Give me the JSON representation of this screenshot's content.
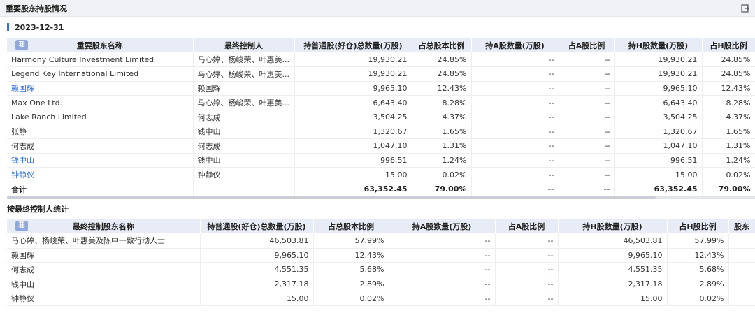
{
  "header": {
    "title": "重要股东持股情况",
    "export_icon": "export-icon"
  },
  "date_label": "2023-12-31",
  "sort_badge": "荘",
  "table1": {
    "columns": [
      "重要股东名称",
      "最终控制人",
      "持普通股(好仓)总数量(万股)",
      "占总股本比例",
      "持A股数量(万股)",
      "占A股比例",
      "持H股数量(万股)",
      "占H股比例"
    ],
    "rows": [
      [
        "Harmony Culture Investment Limited",
        "马心婷、杨峻荣、叶惠美...",
        "19,930.21",
        "24.85%",
        "--",
        "--",
        "19,930.21",
        "24.85%"
      ],
      [
        "Legend Key International Limited",
        "马心婷、杨峻荣、叶惠美...",
        "19,930.21",
        "24.85%",
        "--",
        "--",
        "19,930.21",
        "24.85%"
      ],
      [
        "赖国辉",
        "赖国辉",
        "9,965.10",
        "12.43%",
        "--",
        "--",
        "9,965.10",
        "12.43%"
      ],
      [
        "Max One Ltd.",
        "马心婷、杨峻荣、叶惠美...",
        "6,643.40",
        "8.28%",
        "--",
        "--",
        "6,643.40",
        "8.28%"
      ],
      [
        "Lake Ranch Limited",
        "何志成",
        "3,504.25",
        "4.37%",
        "--",
        "--",
        "3,504.25",
        "4.37%"
      ],
      [
        "张静",
        "钱中山",
        "1,320.67",
        "1.65%",
        "--",
        "--",
        "1,320.67",
        "1.65%"
      ],
      [
        "何志成",
        "何志成",
        "1,047.10",
        "1.31%",
        "--",
        "--",
        "1,047.10",
        "1.31%"
      ],
      [
        "钱中山",
        "钱中山",
        "996.51",
        "1.24%",
        "--",
        "--",
        "996.51",
        "1.24%"
      ],
      [
        "钟静仪",
        "钟静仪",
        "15.00",
        "0.02%",
        "--",
        "--",
        "15.00",
        "0.02%"
      ]
    ],
    "link_rows": [
      2,
      7,
      8
    ],
    "total": [
      "合计",
      "",
      "63,352.45",
      "79.00%",
      "--",
      "--",
      "63,352.45",
      "79.00%"
    ]
  },
  "section2_title": "按最终控制人统计",
  "table2": {
    "columns": [
      "最终控制股东名称",
      "持普通股(好仓)总数量(万股)",
      "占总股本比例",
      "持A股数量(万股)",
      "占A股比例",
      "持H股数量(万股)",
      "占H股比例",
      "股东"
    ],
    "rows": [
      [
        "马心婷、杨峻荣、叶惠美及陈中一致行动人士",
        "46,503.81",
        "57.99%",
        "--",
        "--",
        "46,503.81",
        "57.99%",
        ""
      ],
      [
        "赖国辉",
        "9,965.10",
        "12.43%",
        "--",
        "--",
        "9,965.10",
        "12.43%",
        ""
      ],
      [
        "何志成",
        "4,551.35",
        "5.68%",
        "--",
        "--",
        "4,551.35",
        "5.68%",
        ""
      ],
      [
        "钱中山",
        "2,317.18",
        "2.89%",
        "--",
        "--",
        "2,317.18",
        "2.89%",
        ""
      ],
      [
        "钟静仪",
        "15.00",
        "0.02%",
        "--",
        "--",
        "15.00",
        "0.02%",
        ""
      ]
    ]
  }
}
